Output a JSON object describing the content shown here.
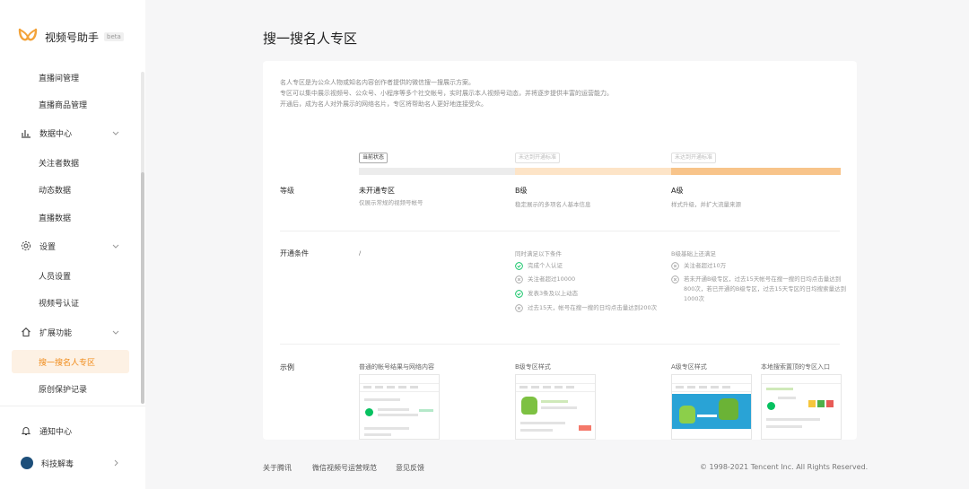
{
  "app": {
    "title": "视频号助手",
    "badge": "beta"
  },
  "sidebar": {
    "items": [
      {
        "label": "直播间管理"
      },
      {
        "label": "直播商品管理"
      },
      {
        "label": "数据中心"
      },
      {
        "label": "关注者数据"
      },
      {
        "label": "动态数据"
      },
      {
        "label": "直播数据"
      },
      {
        "label": "设置"
      },
      {
        "label": "人员设置"
      },
      {
        "label": "视频号认证"
      },
      {
        "label": "扩展功能"
      },
      {
        "label": "搜一搜名人专区"
      },
      {
        "label": "原创保护记录"
      }
    ],
    "bottom": [
      {
        "label": "通知中心"
      },
      {
        "label": "科技解毒"
      }
    ]
  },
  "page": {
    "title": "搜一搜名人专区",
    "intro": [
      "名人专区是为公众人物或知名内容创作者提供的微信搜一搜展示方案。",
      "专区可以集中展示视频号、公众号、小程序等多个社交帐号，实时展示本人视频号动态，并将逐步提供丰富的运营能力。",
      "开通后，成为名人对外展示的网络名片，专区将帮助名人更好地连接受众。"
    ],
    "progress": {
      "tags": [
        "当前状态",
        "未达到开通标准",
        "未达到开通标准"
      ],
      "colors": [
        "#ececec",
        "#fde4c7",
        "#f8c48a"
      ]
    },
    "level": {
      "label": "等级",
      "columns": [
        {
          "title": "未开通专区",
          "sub": "仅展示常规的视频号帐号"
        },
        {
          "title": "B级",
          "sub": "稳定展示的多项名人基本信息"
        },
        {
          "title": "A级",
          "sub": "样式升级，并扩大流量来源"
        }
      ]
    },
    "conditions": {
      "label": "开通条件",
      "none": "/",
      "b_header": "同时满足以下条件",
      "b_items": [
        "完成个人认证",
        "关注者超过10000",
        "发表3条及以上动态",
        "过去15天，帐号在搜一搜的日均点击量达到200次"
      ],
      "a_header": "B级基础上还满足",
      "a_items": [
        "关注者超过10万",
        "若未开通B级专区，过去15天帐号在搜一搜的日均点击量达到800次，若已开通的B级专区，过去15天专区的日均搜索量达到1000次"
      ]
    },
    "examples": {
      "label": "示例",
      "items": [
        "普通的帐号结果与网络内容",
        "B级专区样式",
        "A级专区样式",
        "本地搜索置顶的专区入口"
      ]
    }
  },
  "footer": {
    "links": [
      "关于腾讯",
      "微信视频号运营规范",
      "意见反馈"
    ],
    "copyright": "© 1998-2021 Tencent Inc. All Rights Reserved."
  },
  "colors": {
    "accent": "#f08a18",
    "active_bg": "#fdf1e4",
    "success": "#07c160"
  }
}
